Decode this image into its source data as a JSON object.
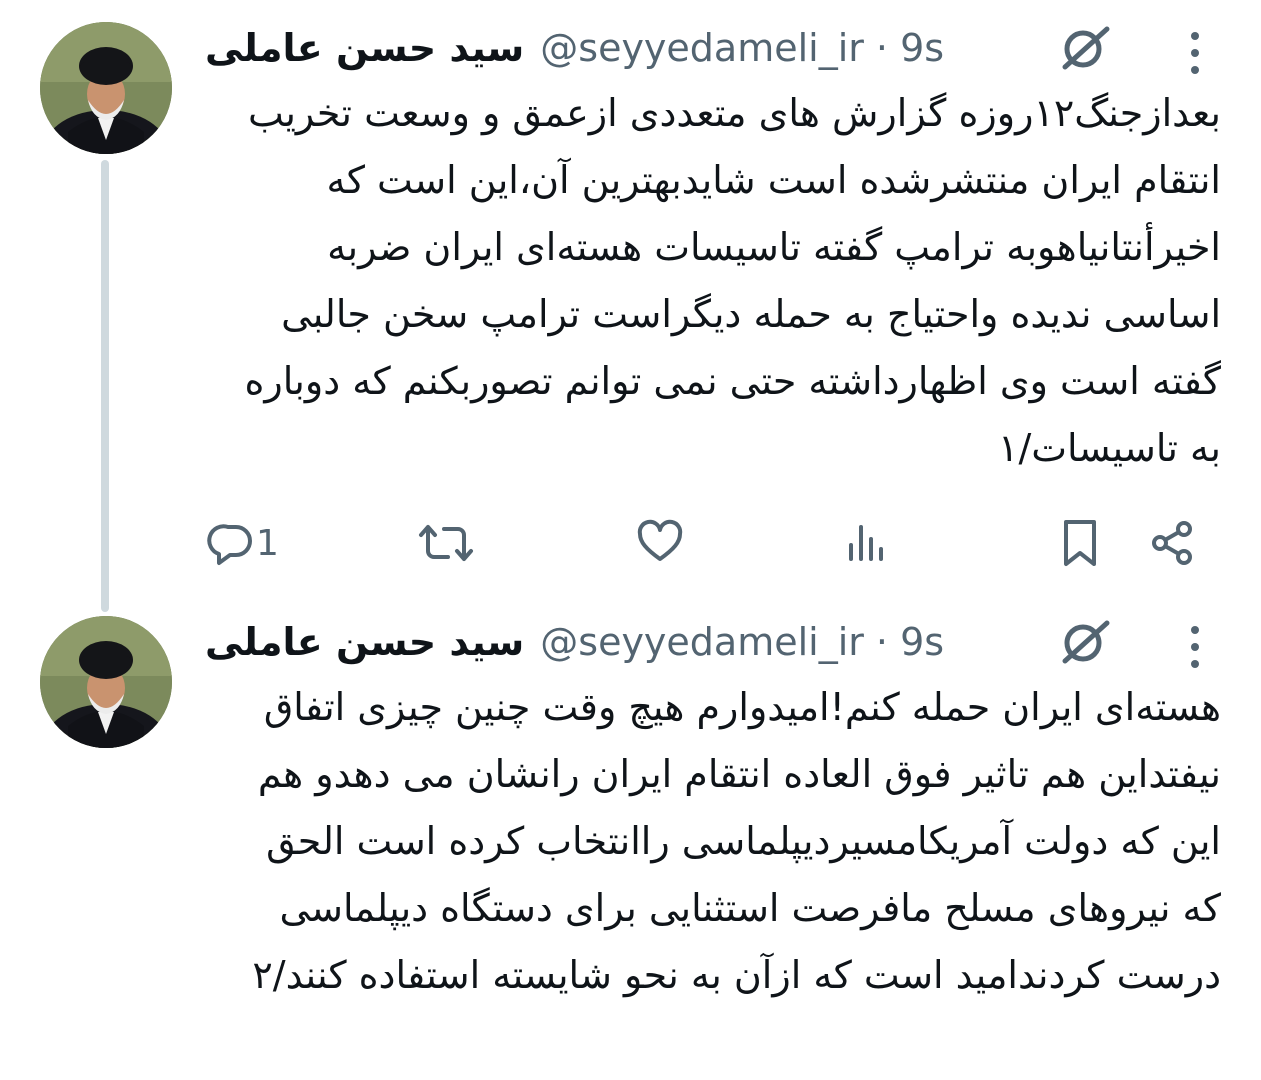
{
  "tweets": [
    {
      "display_name": "سید حسن عاملی",
      "handle": "@seyyedameli_ir",
      "time": "· 9s",
      "body": "بعدازجنگ۱۲روزه گزارش های متعددی ازعمق و وسعت تخریب انتقام ایران منتشرشده است شایدبهترین آن،این است که اخیرأنتانیاهوبه ترامپ گفته تاسیسات هسته‌ای ایران ضربه اساسی ندیده واحتیاج به حمله دیگراست ترامپ سخن جالبی گفته است وی اظهارداشته حتی نمی توانم تصوربکنم که دوباره به تاسیسات/۱",
      "reply_count": "1"
    },
    {
      "display_name": "سید حسن عاملی",
      "handle": "@seyyedameli_ir",
      "time": "· 9s",
      "body": "هسته‌ای ایران حمله کنم!امیدوارم هیچ وقت چنین چیزی اتفاق نیفتداین هم تاثیر فوق العاده انتقام ایران رانشان می دهدو هم این که دولت آمریکامسیردیپلماسی راانتخاب کرده است الحق که نیروهای مسلح مافرصت استثنایی برای دستگاه دیپلماسی درست کردنداميد است که ازآن به نحو شایسته استفاده کنند/۲"
    }
  ],
  "icons": {
    "brand": "grok-slashed-circle-icon",
    "more": "more-vertical-icon",
    "reply": "reply-icon",
    "retweet": "retweet-icon",
    "like": "heart-icon",
    "views": "views-icon",
    "bookmark": "bookmark-icon",
    "share": "share-icon"
  },
  "colors": {
    "text": "#0f1419",
    "secondary": "#536471",
    "thread_line": "#cfd9de"
  }
}
